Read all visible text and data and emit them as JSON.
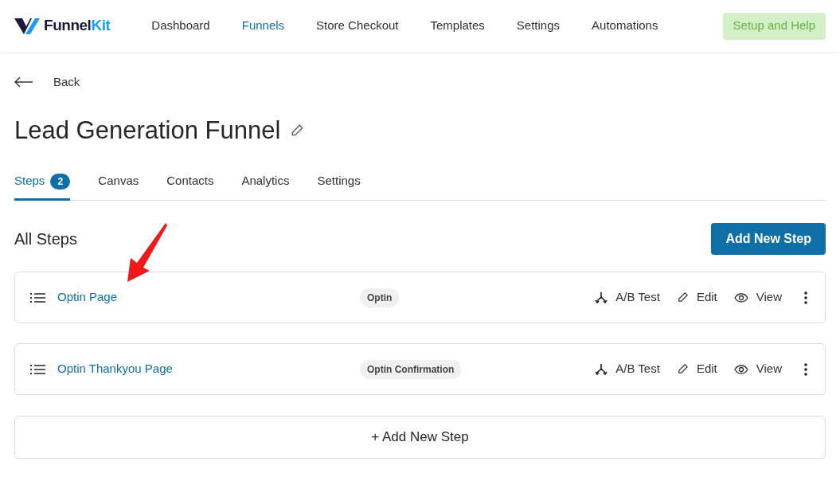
{
  "logo": {
    "name": "Funnel",
    "accent": "Kit"
  },
  "nav": [
    {
      "label": "Dashboard",
      "selected": false
    },
    {
      "label": "Funnels",
      "selected": true
    },
    {
      "label": "Store Checkout",
      "selected": false
    },
    {
      "label": "Templates",
      "selected": false
    },
    {
      "label": "Settings",
      "selected": false
    },
    {
      "label": "Automations",
      "selected": false
    }
  ],
  "help_button": "Setup and Help",
  "back": "Back",
  "title": "Lead Generation Funnel",
  "tabs": [
    {
      "label": "Steps",
      "count": "2",
      "selected": true
    },
    {
      "label": "Canvas",
      "selected": false
    },
    {
      "label": "Contacts",
      "selected": false
    },
    {
      "label": "Analytics",
      "selected": false
    },
    {
      "label": "Settings",
      "selected": false
    }
  ],
  "section_title": "All Steps",
  "add_button": "Add New Step",
  "steps": [
    {
      "name": "Optin Page",
      "tag": "Optin",
      "actions": [
        "A/B Test",
        "Edit",
        "View"
      ]
    },
    {
      "name": "Optin Thankyou Page",
      "tag": "Optin Confirmation",
      "actions": [
        "A/B Test",
        "Edit",
        "View"
      ]
    }
  ],
  "add_step_bar": "+ Add New Step"
}
